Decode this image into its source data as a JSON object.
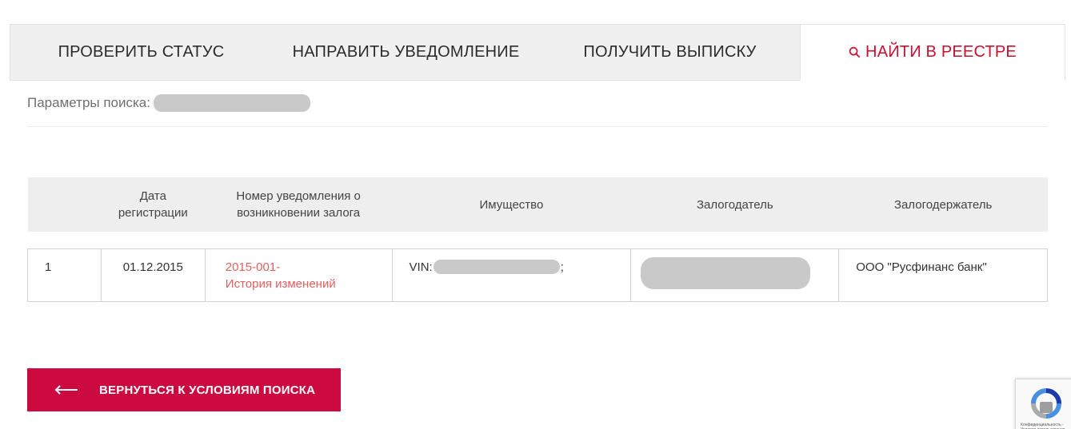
{
  "tabs": [
    {
      "label": "ПРОВЕРИТЬ СТАТУС"
    },
    {
      "label": "НАПРАВИТЬ УВЕДОМЛЕНИЕ"
    },
    {
      "label": "ПОЛУЧИТЬ ВЫПИСКУ"
    },
    {
      "label": "НАЙТИ В РЕЕСТРЕ",
      "icon": "search-icon",
      "active": true
    }
  ],
  "search_params": {
    "label": "Параметры поиска:"
  },
  "table": {
    "headers": [
      "",
      "Дата регистрации",
      "Номер уведомления о возникновении залога",
      "Имущество",
      "Залогодатель",
      "Залогодержатель"
    ],
    "rows": [
      {
        "index": "1",
        "date": "01.12.2015",
        "notice_number": "2015-001-",
        "history_link": "История изменений",
        "property_prefix": "VIN:",
        "property_suffix": ";",
        "pledgee": "ООО \"Русфинанс банк\""
      }
    ]
  },
  "back_button": {
    "label": "ВЕРНУТЬСЯ К УСЛОВИЯМ ПОИСКА",
    "icon": "arrow-left-icon"
  },
  "recaptcha": {
    "text": "Конфиденциальность - Условия использования",
    "icon": "recaptcha-logo-icon"
  },
  "colors": {
    "accent": "#cc0a3f",
    "link": "#e06060",
    "tab_bg": "#f0f0f0",
    "header_bg": "#eeeeee"
  }
}
